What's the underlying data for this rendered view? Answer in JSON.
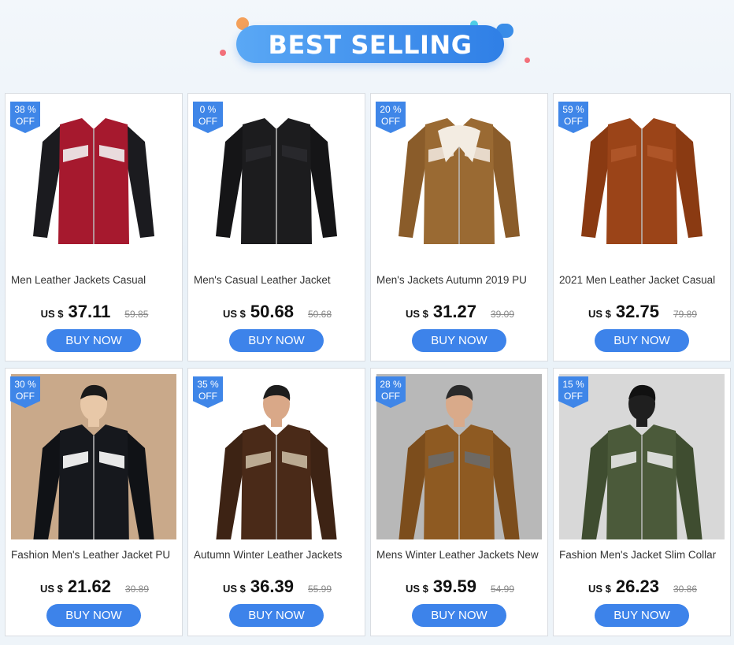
{
  "banner": {
    "title": "BEST SELLING"
  },
  "products": [
    {
      "discount": "38 %",
      "off": "OFF",
      "name": "Men Leather Jackets Casual",
      "currency": "US $",
      "price": "37.11",
      "old_price": "59.85",
      "buy": "BUY NOW",
      "icon": "red-black-jacket-image"
    },
    {
      "discount": "0 %",
      "off": "OFF",
      "name": "Men's Casual Leather Jacket",
      "currency": "US $",
      "price": "50.68",
      "old_price": "50.68",
      "buy": "BUY NOW",
      "icon": "black-leather-jacket-image"
    },
    {
      "discount": "20 %",
      "off": "OFF",
      "name": "Men's Jackets Autumn 2019 PU",
      "currency": "US $",
      "price": "31.27",
      "old_price": "39.09",
      "buy": "BUY NOW",
      "icon": "brown-fur-jacket-image"
    },
    {
      "discount": "59 %",
      "off": "OFF",
      "name": "2021 Men Leather Jacket Casual",
      "currency": "US $",
      "price": "32.75",
      "old_price": "79.89",
      "buy": "BUY NOW",
      "icon": "rust-leather-jacket-image"
    },
    {
      "discount": "30 %",
      "off": "OFF",
      "name": "Fashion Men's Leather Jacket PU",
      "currency": "US $",
      "price": "21.62",
      "old_price": "30.89",
      "buy": "BUY NOW",
      "icon": "model-black-jacket-image"
    },
    {
      "discount": "35 %",
      "off": "OFF",
      "name": "Autumn Winter Leather Jackets",
      "currency": "US $",
      "price": "36.39",
      "old_price": "55.99",
      "buy": "BUY NOW",
      "icon": "model-brown-jacket-image"
    },
    {
      "discount": "28 %",
      "off": "OFF",
      "name": "Mens Winter Leather Jackets New",
      "currency": "US $",
      "price": "39.59",
      "old_price": "54.99",
      "buy": "BUY NOW",
      "icon": "model-tan-jacket-image"
    },
    {
      "discount": "15 %",
      "off": "OFF",
      "name": "Fashion Men's Jacket Slim Collar",
      "currency": "US $",
      "price": "26.23",
      "old_price": "30.86",
      "buy": "BUY NOW",
      "icon": "model-green-jacket-image"
    }
  ],
  "colors": {
    "accent": "#3d83ea",
    "badge": "#3f86e8"
  }
}
